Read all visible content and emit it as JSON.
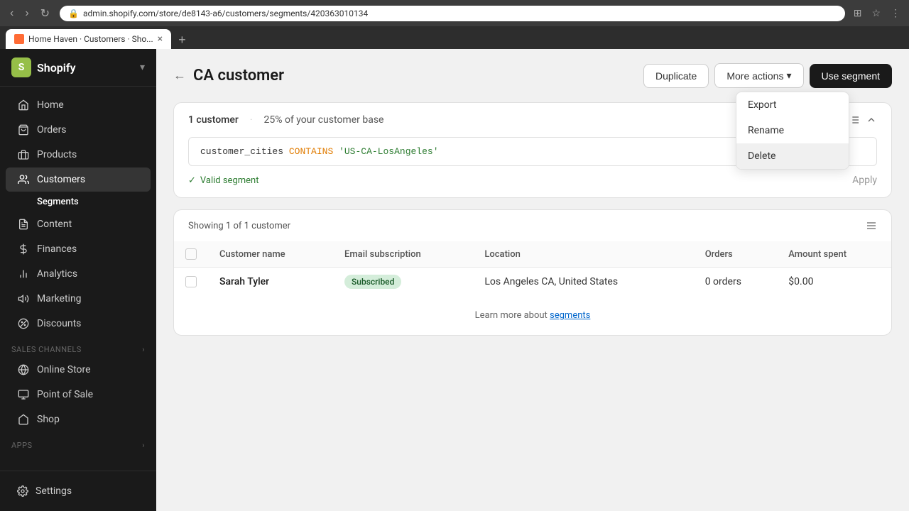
{
  "browser": {
    "url": "admin.shopify.com/store/de8143-a6/customers/segments/420363010134",
    "tab_title": "Home Haven · Customers · Sho...",
    "tab_close": "×",
    "tab_add": "+"
  },
  "sidebar": {
    "logo_text": "Shopify",
    "store_selector_icon": "▾",
    "nav_items": [
      {
        "id": "home",
        "label": "Home",
        "icon": "house"
      },
      {
        "id": "orders",
        "label": "Orders",
        "icon": "cart"
      },
      {
        "id": "products",
        "label": "Products",
        "icon": "tag"
      },
      {
        "id": "customers",
        "label": "Customers",
        "icon": "person",
        "active": true
      },
      {
        "id": "content",
        "label": "Content",
        "icon": "file"
      },
      {
        "id": "finances",
        "label": "Finances",
        "icon": "dollar"
      },
      {
        "id": "analytics",
        "label": "Analytics",
        "icon": "chart"
      },
      {
        "id": "marketing",
        "label": "Marketing",
        "icon": "megaphone"
      },
      {
        "id": "discounts",
        "label": "Discounts",
        "icon": "percent"
      }
    ],
    "sub_items": [
      {
        "id": "segments",
        "label": "Segments",
        "active": true
      }
    ],
    "sales_channels_label": "Sales channels",
    "sales_channels_toggle": "›",
    "sales_channels": [
      {
        "id": "online-store",
        "label": "Online Store"
      },
      {
        "id": "point-of-sale",
        "label": "Point of Sale"
      },
      {
        "id": "shop",
        "label": "Shop"
      }
    ],
    "apps_label": "Apps",
    "apps_toggle": "›",
    "settings_label": "Settings"
  },
  "page": {
    "back_label": "←",
    "title": "CA customer",
    "duplicate_label": "Duplicate",
    "more_actions_label": "More actions",
    "more_actions_chevron": "▾",
    "use_segment_label": "Use segment",
    "dropdown": {
      "export_label": "Export",
      "rename_label": "Rename",
      "delete_label": "Delete"
    }
  },
  "segment_editor": {
    "customer_count": "1 customer",
    "customer_base_pct": "25% of your customer base",
    "code_field": "customer_cities",
    "code_operator": "CONTAINS",
    "code_value": "'US-CA-LosAngeles'",
    "valid_label": "Valid segment",
    "apply_label": "Apply"
  },
  "customers_table": {
    "showing_label": "Showing 1 of 1 customer",
    "columns": [
      {
        "id": "name",
        "label": "Customer name"
      },
      {
        "id": "email",
        "label": "Email subscription"
      },
      {
        "id": "location",
        "label": "Location"
      },
      {
        "id": "orders",
        "label": "Orders"
      },
      {
        "id": "amount",
        "label": "Amount spent"
      }
    ],
    "rows": [
      {
        "name": "Sarah Tyler",
        "email_status": "Subscribed",
        "location": "Los Angeles CA, United States",
        "orders": "0 orders",
        "amount": "$0.00"
      }
    ],
    "learn_more_text": "Learn more about ",
    "learn_more_link": "segments"
  }
}
